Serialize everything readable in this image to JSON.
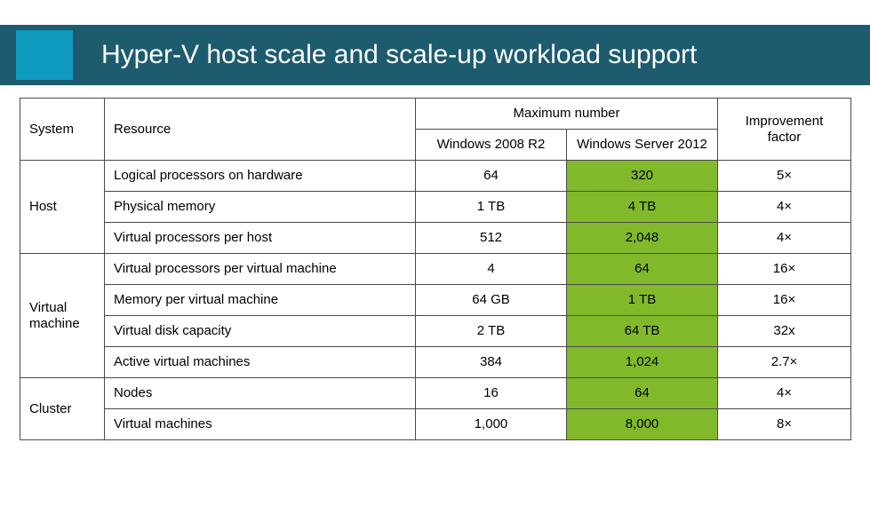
{
  "title": "Hyper-V host scale and scale-up workload support",
  "headers": {
    "system": "System",
    "resource": "Resource",
    "max_number": "Maximum number",
    "win2008": "Windows 2008 R2",
    "win2012": "Windows Server 2012",
    "improvement": "Improvement factor"
  },
  "groups": [
    {
      "name": "Host",
      "span": 3
    },
    {
      "name": "Virtual machine",
      "span": 4
    },
    {
      "name": "Cluster",
      "span": 2
    }
  ],
  "rows": [
    {
      "resource": "Logical processors on hardware",
      "w08": "64",
      "w12": "320",
      "imp": "5×"
    },
    {
      "resource": "Physical memory",
      "w08": "1 TB",
      "w12": "4 TB",
      "imp": "4×"
    },
    {
      "resource": "Virtual processors per host",
      "w08": "512",
      "w12": "2,048",
      "imp": "4×"
    },
    {
      "resource": "Virtual processors per virtual machine",
      "w08": "4",
      "w12": "64",
      "imp": "16×"
    },
    {
      "resource": "Memory per virtual machine",
      "w08": "64 GB",
      "w12": "1 TB",
      "imp": "16×"
    },
    {
      "resource": "Virtual disk capacity",
      "w08": "2 TB",
      "w12": "64 TB",
      "imp": "32x"
    },
    {
      "resource": "Active virtual machines",
      "w08": "384",
      "w12": "1,024",
      "imp": "2.7×"
    },
    {
      "resource": "Nodes",
      "w08": "16",
      "w12": "64",
      "imp": "4×"
    },
    {
      "resource": "Virtual machines",
      "w08": "1,000",
      "w12": "8,000",
      "imp": "8×"
    }
  ],
  "chart_data": {
    "type": "table",
    "title": "Hyper-V host scale and scale-up workload support",
    "columns": [
      "System",
      "Resource",
      "Windows 2008 R2",
      "Windows Server 2012",
      "Improvement factor"
    ],
    "data": [
      [
        "Host",
        "Logical processors on hardware",
        64,
        320,
        5
      ],
      [
        "Host",
        "Physical memory (TB)",
        1,
        4,
        4
      ],
      [
        "Host",
        "Virtual processors per host",
        512,
        2048,
        4
      ],
      [
        "Virtual machine",
        "Virtual processors per virtual machine",
        4,
        64,
        16
      ],
      [
        "Virtual machine",
        "Memory per virtual machine (GB)",
        64,
        1024,
        16
      ],
      [
        "Virtual machine",
        "Virtual disk capacity (TB)",
        2,
        64,
        32
      ],
      [
        "Virtual machine",
        "Active virtual machines",
        384,
        1024,
        2.7
      ],
      [
        "Cluster",
        "Nodes",
        16,
        64,
        4
      ],
      [
        "Cluster",
        "Virtual machines",
        1000,
        8000,
        8
      ]
    ]
  }
}
